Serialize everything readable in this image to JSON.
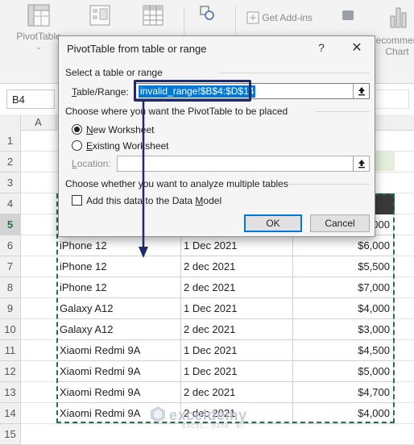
{
  "ribbon": {
    "pivot_label": "PivotTable",
    "pivot_chevron": "⌄",
    "addins_label": "Get Add-ins",
    "recommend_label_1": "ecommen",
    "recommend_label_2": "Chart",
    "icons": [
      "pivottable-icon",
      "recommended-pivot-icon",
      "table-icon",
      "shapes-icon",
      "store-icon",
      "visio-icon",
      "bar-chart-icon"
    ]
  },
  "formula_bar": {
    "name_box": "B4"
  },
  "grid": {
    "columns": [
      "A"
    ],
    "rows": [
      "1",
      "2",
      "3",
      "4",
      "5",
      "6",
      "7",
      "8",
      "9",
      "10",
      "11",
      "12",
      "13",
      "14",
      "15"
    ],
    "active_row": "5",
    "data_rows": [
      {
        "product": "",
        "date": "",
        "amount": "000"
      },
      {
        "product": "iPhone 12",
        "date": "1 Dec 2021",
        "amount": "$6,000"
      },
      {
        "product": "iPhone 12",
        "date": "2 dec 2021",
        "amount": "$5,500"
      },
      {
        "product": "iPhone 12",
        "date": "2 dec 2021",
        "amount": "$7,000"
      },
      {
        "product": "Galaxy A12",
        "date": "1 Dec 2021",
        "amount": "$4,000"
      },
      {
        "product": "Galaxy A12",
        "date": "2 dec 2021",
        "amount": "$3,000"
      },
      {
        "product": "Xiaomi Redmi 9A",
        "date": "1 Dec 2021",
        "amount": "$4,500"
      },
      {
        "product": "Xiaomi Redmi 9A",
        "date": "1 Dec 2021",
        "amount": "$5,000"
      },
      {
        "product": "Xiaomi Redmi 9A",
        "date": "2 dec 2021",
        "amount": "$4,700"
      },
      {
        "product": "Xiaomi Redmi 9A",
        "date": "2 dec 2021",
        "amount": "$4,000"
      }
    ]
  },
  "dialog": {
    "title": "PivotTable from table or range",
    "help": "?",
    "close": "✕",
    "section1": "Select a table or range",
    "range_label_u": "T",
    "range_label_rest": "able/Range:",
    "range_value": "invalid_range!$B$4:$D$14",
    "section2": "Choose where you want the PivotTable to be placed",
    "opt_new_u": "N",
    "opt_new_rest": "ew Worksheet",
    "opt_existing_u": "E",
    "opt_existing_rest": "xisting Worksheet",
    "location_label_u": "L",
    "location_label_rest": "ocation:",
    "location_value": "",
    "section3": "Choose whether you want to analyze multiple tables",
    "add_model_label": "Add this data to the Data ",
    "add_model_u": "M",
    "add_model_rest": "odel",
    "ok": "OK",
    "cancel": "Cancel",
    "new_worksheet_selected": true,
    "add_model_checked": false
  },
  "watermark": {
    "brand": "exceldemy",
    "tagline": "EXCEL · DATA · BI"
  },
  "colors": {
    "accent": "#0078d7",
    "excel_green": "#217346",
    "annotation": "#1f2a6b"
  }
}
